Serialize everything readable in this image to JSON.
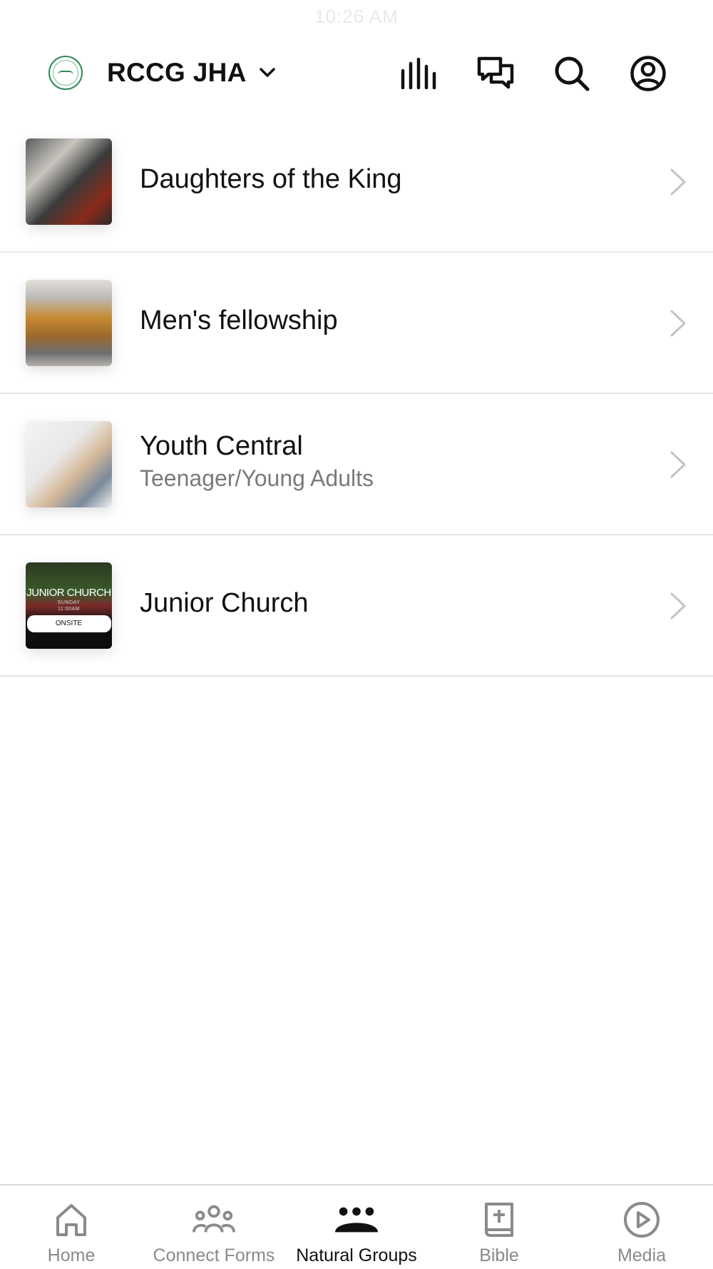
{
  "status_bar": {
    "time": "10:26 AM"
  },
  "header": {
    "org_name": "RCCG JHA",
    "icons": [
      "logo-icon",
      "chevron-down-icon",
      "activity-icon",
      "chat-icon",
      "search-icon",
      "profile-icon"
    ]
  },
  "groups": [
    {
      "title": "Daughters of the King",
      "subtitle": ""
    },
    {
      "title": "Men's fellowship",
      "subtitle": ""
    },
    {
      "title": "Youth Central",
      "subtitle": "Teenager/Young Adults"
    },
    {
      "title": "Junior Church",
      "subtitle": "",
      "thumb_text": {
        "title": "JUNIOR CHURCH",
        "line1": "SUNDAY",
        "line2": "11:00AM",
        "button": "ONSITE"
      }
    }
  ],
  "tabs": [
    {
      "label": "Home",
      "icon": "home-icon",
      "active": false
    },
    {
      "label": "Connect Forms",
      "icon": "people-icon",
      "active": false
    },
    {
      "label": "Natural Groups",
      "icon": "groups-icon",
      "active": true
    },
    {
      "label": "Bible",
      "icon": "bible-icon",
      "active": false
    },
    {
      "label": "Media",
      "icon": "play-icon",
      "active": false
    }
  ],
  "colors": {
    "accent_green": "#2e8b57",
    "text_primary": "#111111",
    "text_secondary": "#7a7a7a",
    "tab_inactive": "#8a8a8a",
    "divider": "#e6e6e6"
  }
}
